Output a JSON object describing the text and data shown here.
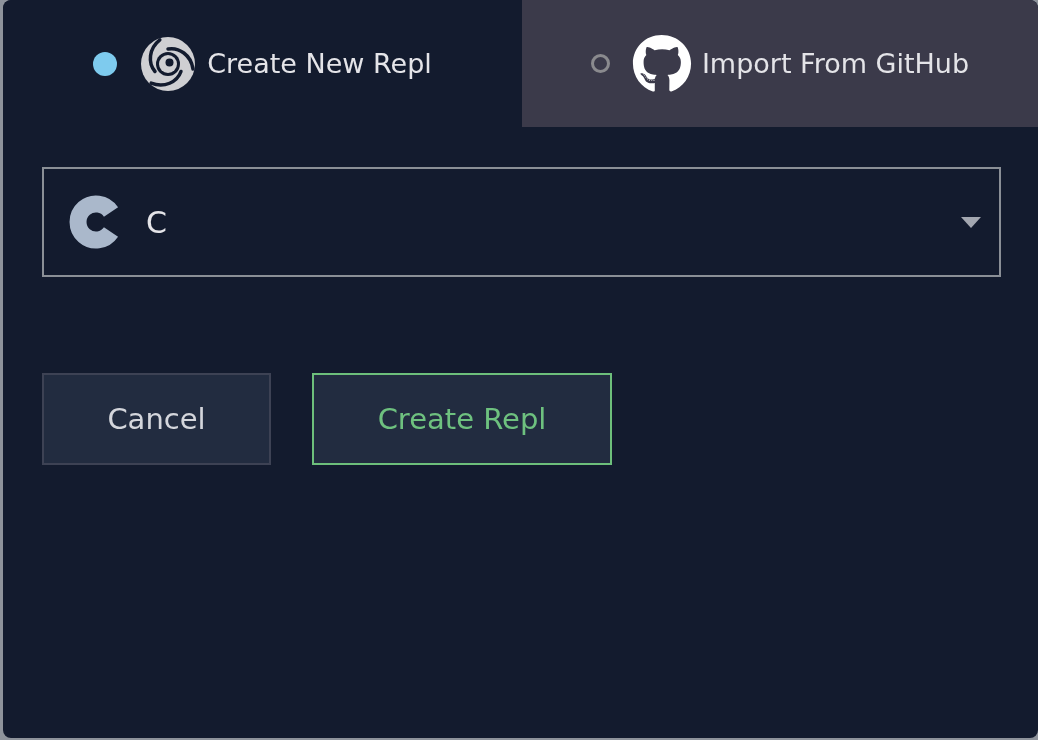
{
  "tabs": [
    {
      "label": "Create New Repl",
      "kind": "create",
      "selected": true
    },
    {
      "label": "Import From GitHub",
      "kind": "import",
      "selected": false
    }
  ],
  "language_select": {
    "value": "C"
  },
  "buttons": [
    {
      "label": "Cancel",
      "kind": "secondary"
    },
    {
      "label": "Create Repl",
      "kind": "primary"
    }
  ]
}
